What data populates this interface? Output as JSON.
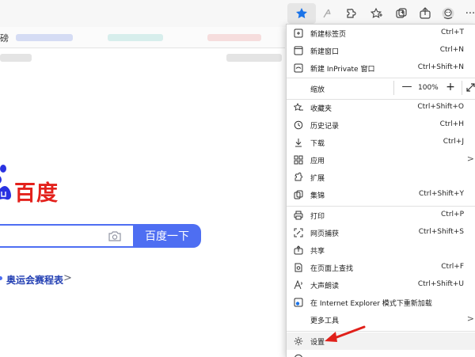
{
  "toolbar": {
    "icons": [
      "favorites-star-icon",
      "read-aloud-icon",
      "extensions-icon",
      "favorites-icon",
      "collections-icon",
      "share-icon",
      "profile-avatar-icon",
      "more-icon"
    ],
    "more_label": "···"
  },
  "bookmarks": {
    "partial_label": "磅"
  },
  "baidu": {
    "logo_text": "百度",
    "search_button": "百度一下",
    "search_value": "",
    "hot_link": "奥运会赛程表",
    "hot_chevron": ">"
  },
  "menu": {
    "items_top": [
      {
        "label": "新建标签页",
        "shortcut": "Ctrl+T",
        "icon": "new-tab-icon"
      },
      {
        "label": "新建窗口",
        "shortcut": "Ctrl+N",
        "icon": "new-window-icon"
      },
      {
        "label": "新建 InPrivate 窗口",
        "shortcut": "Ctrl+Shift+N",
        "icon": "inprivate-icon"
      }
    ],
    "zoom": {
      "label": "缩放",
      "minus": "—",
      "value": "100%",
      "plus": "+"
    },
    "items_mid": [
      {
        "label": "收藏夹",
        "shortcut": "Ctrl+Shift+O",
        "icon": "favorites-icon"
      },
      {
        "label": "历史记录",
        "shortcut": "Ctrl+H",
        "icon": "history-icon"
      },
      {
        "label": "下载",
        "shortcut": "Ctrl+J",
        "icon": "download-icon"
      },
      {
        "label": "应用",
        "shortcut": "",
        "icon": "apps-icon",
        "arrow": ">"
      },
      {
        "label": "扩展",
        "shortcut": "",
        "icon": "extensions-icon"
      },
      {
        "label": "集锦",
        "shortcut": "Ctrl+Shift+Y",
        "icon": "collections-icon"
      }
    ],
    "items_bottom": [
      {
        "label": "打印",
        "shortcut": "Ctrl+P",
        "icon": "print-icon"
      },
      {
        "label": "网页捕获",
        "shortcut": "Ctrl+Shift+S",
        "icon": "web-capture-icon"
      },
      {
        "label": "共享",
        "shortcut": "",
        "icon": "share-icon"
      },
      {
        "label": "在页面上查找",
        "shortcut": "Ctrl+F",
        "icon": "find-icon"
      },
      {
        "label": "大声朗读",
        "shortcut": "Ctrl+Shift+U",
        "icon": "read-aloud-icon"
      },
      {
        "label": "在 Internet Explorer 模式下重新加载",
        "shortcut": "",
        "icon": "ie-mode-icon"
      },
      {
        "label": "更多工具",
        "shortcut": "",
        "icon": "",
        "arrow": ">"
      }
    ],
    "settings": {
      "label": "设置",
      "icon": "settings-icon"
    },
    "annotation_color": "#e0201a"
  }
}
